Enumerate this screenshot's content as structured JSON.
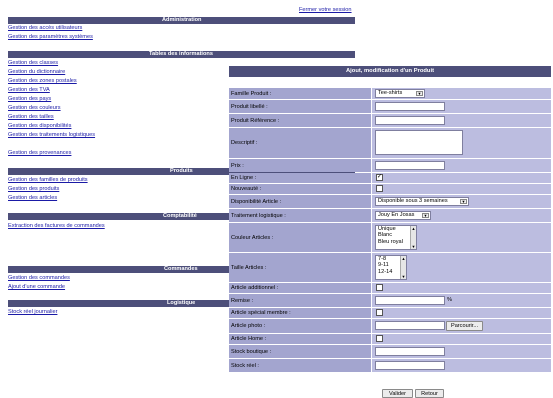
{
  "header": {
    "logout_link": "Fermer votre session"
  },
  "sections": {
    "administration": {
      "title": "Administration",
      "links": [
        "Gestion des accès utilisateurs",
        "Gestion des paramètres systèmes"
      ]
    },
    "tables": {
      "title": "Tables des informations",
      "links": [
        "Gestion des classes",
        "Gestion du dictionnaire",
        "Gestion des zones postales",
        "Gestion des TVA",
        "Gestion des pays",
        "Gestion des couleurs",
        "Gestion des tailles",
        "Gestion des disponibilités",
        "Gestion des traitements logistiques",
        "Gestion des provenances"
      ]
    },
    "produits": {
      "title": "Produits",
      "links": [
        "Gestion des familles de produits",
        "Gestion des produits",
        "Gestion des articles"
      ]
    },
    "comptabilite": {
      "title": "Comptabilité",
      "links": [
        "Extraction des factures de commandes"
      ]
    },
    "commandes": {
      "title": "Commandes",
      "links": [
        "Gestion des commandes",
        "Ajout d'une commande"
      ]
    },
    "logistique": {
      "title": "Logistique",
      "links": [
        "Stock réel journalier"
      ]
    }
  },
  "form": {
    "title": "Ajout, modification d'un Produit",
    "labels": {
      "famille": "Famille Produit :",
      "libelle": "Produit libellé :",
      "reference": "Produit Référence :",
      "descriptif": "Descriptif :",
      "prix": "Prix :",
      "en_ligne": "En Ligne :",
      "nouveaute": "Nouveauté :",
      "disponibilite": "Disponibilité Article :",
      "traitement": "Traitement logistique :",
      "couleur": "Couleur Articles :",
      "taille": "Taille Articles :",
      "additionnel": "Article additionnel :",
      "remise": "Remise :",
      "special_membre": "Article spécial membre :",
      "photo": "Article photo :",
      "home": "Article Home :",
      "stock_boutique": "Stock boutique :",
      "stock_reel": "Stock réel :"
    },
    "values": {
      "famille": "Tee-shirts",
      "libelle": "",
      "reference": "",
      "descriptif": "",
      "prix": "",
      "en_ligne": true,
      "nouveaute": false,
      "disponibilite": "Disponible sous 3 semaines",
      "traitement": "Jouy En Josas",
      "couleur_options": [
        "Unique",
        "Blanc",
        "Bleu royal"
      ],
      "taille_options": [
        "7-8",
        "9-11",
        "12-14"
      ],
      "additionnel": false,
      "remise": "",
      "remise_unit": "%",
      "special_membre": false,
      "photo": "",
      "home": false,
      "stock_boutique": "",
      "stock_reel": ""
    },
    "buttons": {
      "browse": "Parcourir...",
      "validate": "Valider",
      "back": "Retour"
    }
  }
}
